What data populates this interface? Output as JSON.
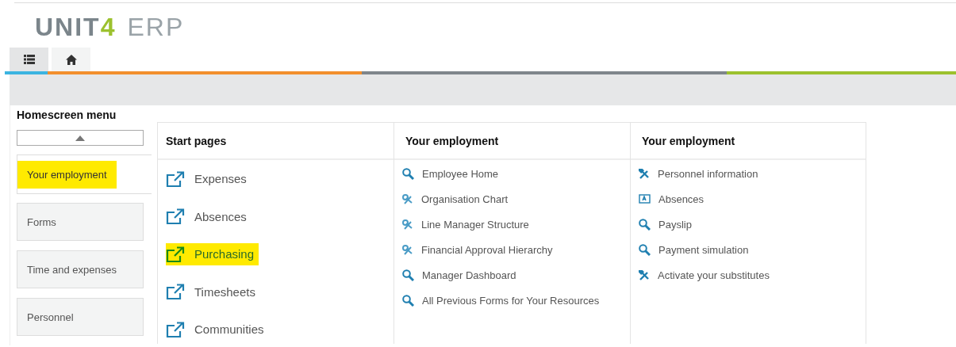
{
  "logo": {
    "name": "UNIT",
    "digit": "4",
    "product": "ERP"
  },
  "tabs": [
    {
      "kind": "list",
      "selected": true
    },
    {
      "kind": "home",
      "selected": false
    }
  ],
  "menu": {
    "title": "Homescreen menu",
    "categories": [
      {
        "label": "Your employment",
        "selected": true,
        "highlighted": true
      },
      {
        "label": "Forms",
        "selected": false,
        "highlighted": false
      },
      {
        "label": "Time and expenses",
        "selected": false,
        "highlighted": false
      },
      {
        "label": "Personnel",
        "selected": false,
        "highlighted": false
      }
    ],
    "columns": [
      {
        "title": "Start pages",
        "kind": "large",
        "items": [
          {
            "label": "Expenses",
            "kind": "external",
            "highlighted": false
          },
          {
            "label": "Absences",
            "kind": "external",
            "highlighted": false
          },
          {
            "label": "Purchasing",
            "kind": "external",
            "highlighted": true
          },
          {
            "label": "Timesheets",
            "kind": "external",
            "highlighted": false
          },
          {
            "label": "Communities",
            "kind": "external",
            "highlighted": false
          }
        ]
      },
      {
        "title": "Your employment",
        "kind": "small",
        "items": [
          {
            "label": "Employee Home",
            "kind": "search",
            "highlighted": false
          },
          {
            "label": "Organisation Chart",
            "kind": "tools-light",
            "highlighted": false
          },
          {
            "label": "Line Manager Structure",
            "kind": "tools-light",
            "highlighted": false
          },
          {
            "label": "Financial Approval Hierarchy",
            "kind": "tools-light",
            "highlighted": false
          },
          {
            "label": "Manager Dashboard",
            "kind": "search",
            "highlighted": false
          },
          {
            "label": "All Previous Forms for Your Resources",
            "kind": "search",
            "highlighted": false
          }
        ]
      },
      {
        "title": "Your employment",
        "kind": "small",
        "items": [
          {
            "label": "Personnel information",
            "kind": "tools",
            "highlighted": false
          },
          {
            "label": "Absences",
            "kind": "form",
            "highlighted": false
          },
          {
            "label": "Payslip",
            "kind": "search",
            "highlighted": false
          },
          {
            "label": "Payment simulation",
            "kind": "search",
            "highlighted": false
          },
          {
            "label": "Activate your substitutes",
            "kind": "tools",
            "highlighted": false
          }
        ]
      }
    ]
  }
}
